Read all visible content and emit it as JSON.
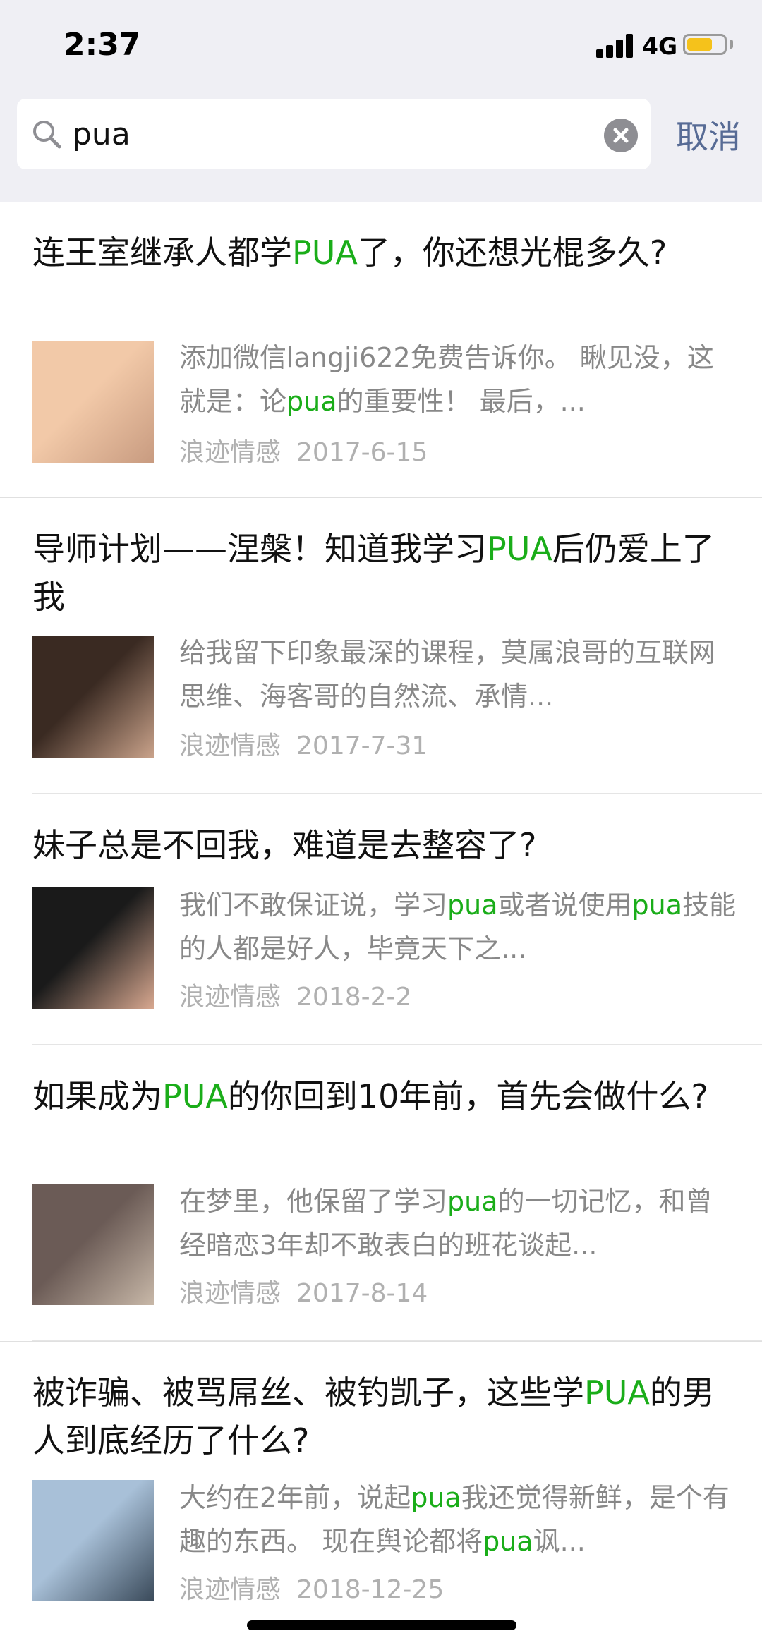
{
  "status_bar": {
    "time": "2:37",
    "network": "4G",
    "battery_level": 0.7
  },
  "search": {
    "query": "pua",
    "cancel_label": "取消"
  },
  "results": [
    {
      "title": "连王室继承人都学PUA了，你还想光棍多久?",
      "desc": "添加微信langji622免费告诉你。 瞅见没，这就是：论pua的重要性！ 最后，...",
      "source": "浪迹情感",
      "date": "2017-6-15",
      "thumb_colors": [
        "#f2c9a8",
        "#c89b80"
      ]
    },
    {
      "title": "导师计划——涅槃！知道我学习PUA后仍爱上了我",
      "desc": "给我留下印象最深的课程，莫属浪哥的互联网思维、海客哥的自然流、承情...",
      "source": "浪迹情感",
      "date": "2017-7-31",
      "thumb_colors": [
        "#3a2a22",
        "#c9a28a"
      ]
    },
    {
      "title": "妹子总是不回我，难道是去整容了?",
      "desc": "我们不敢保证说，学习pua或者说使用pua技能的人都是好人，毕竟天下之...",
      "source": "浪迹情感",
      "date": "2018-2-2",
      "thumb_colors": [
        "#1a1a1a",
        "#d8a890"
      ]
    },
    {
      "title": "如果成为PUA的你回到10年前，首先会做什么?",
      "desc": "在梦里，他保留了学习pua的一切记忆，和曾经暗恋3年却不敢表白的班花谈起...",
      "source": "浪迹情感",
      "date": "2017-8-14",
      "thumb_colors": [
        "#6b5b56",
        "#c8b8a8"
      ]
    },
    {
      "title": "被诈骗、被骂屌丝、被钓凯子，这些学PUA的男人到底经历了什么?",
      "desc": "大约在2年前，说起pua我还觉得新鲜，是个有趣的东西。 现在舆论都将pua讽...",
      "source": "浪迹情感",
      "date": "2018-12-25",
      "thumb_colors": [
        "#a8c0d8",
        "#3a4a5a"
      ]
    }
  ]
}
